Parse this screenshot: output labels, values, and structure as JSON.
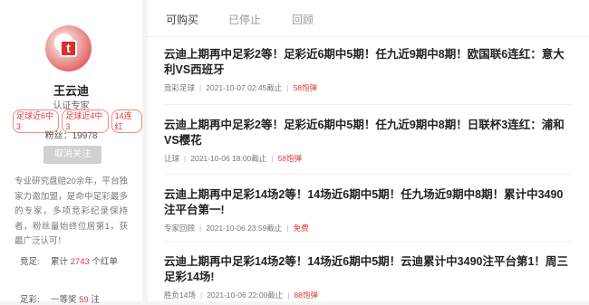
{
  "profile": {
    "name": "王云迪",
    "certification": "认证专家",
    "tags": [
      "足球近6中3",
      "足球近4中3",
      "14连红"
    ],
    "fans_label": "粉丝：",
    "fans_count": "19978",
    "unfollow_label": "取消关注",
    "description": "专业研究盘赔20余年，平台独家力邀加盟，是命中足彩最多的专家，多项竞彩纪录保持者，粉丝量始终位居第1，获最广泛认可！",
    "stats": [
      {
        "label": "竞足:",
        "prefix": "累计 ",
        "value": "2743",
        "suffix": " 个红单"
      },
      {
        "label": "足彩:",
        "prefix": "一等奖 ",
        "value": "59",
        "suffix": " 注"
      }
    ]
  },
  "tabs": [
    {
      "label": "可购买"
    },
    {
      "label": "已停止"
    },
    {
      "label": "回顾"
    }
  ],
  "items": [
    {
      "title": "云迪上期再中足彩2等！足彩近6期中5期！任九近9期中8期！欧国联6连红：意大利VS西班牙",
      "category": "竞彩足球",
      "deadline": "2021-10-07 02:45截止",
      "price": "58饱弹"
    },
    {
      "title": "云迪上期再中足彩2等！足彩近6期中5期！任九近9期中8期！日联杯3连红：浦和VS樱花",
      "category": "让球",
      "deadline": "2021-10-06 18:00截止",
      "price": "58饱弹"
    },
    {
      "title": "云迪上期再中足彩14场2等！14场近6期中5期！任九场近9期中8期！累计中3490注平台第一!",
      "category": "专家回顾",
      "deadline": "2021-10-06 23:59截止",
      "price": "免费"
    },
    {
      "title": "云迪上期再中足彩14场2等！14场近6期中5期！云迪累计中3490注平台第1！周三足彩14场!",
      "category": "胜负14场",
      "deadline": "2021-10-06 22:00截止",
      "price": "88饱弹"
    }
  ],
  "colors": {
    "accent": "#e03a3a",
    "divider": "#eeeeee"
  }
}
